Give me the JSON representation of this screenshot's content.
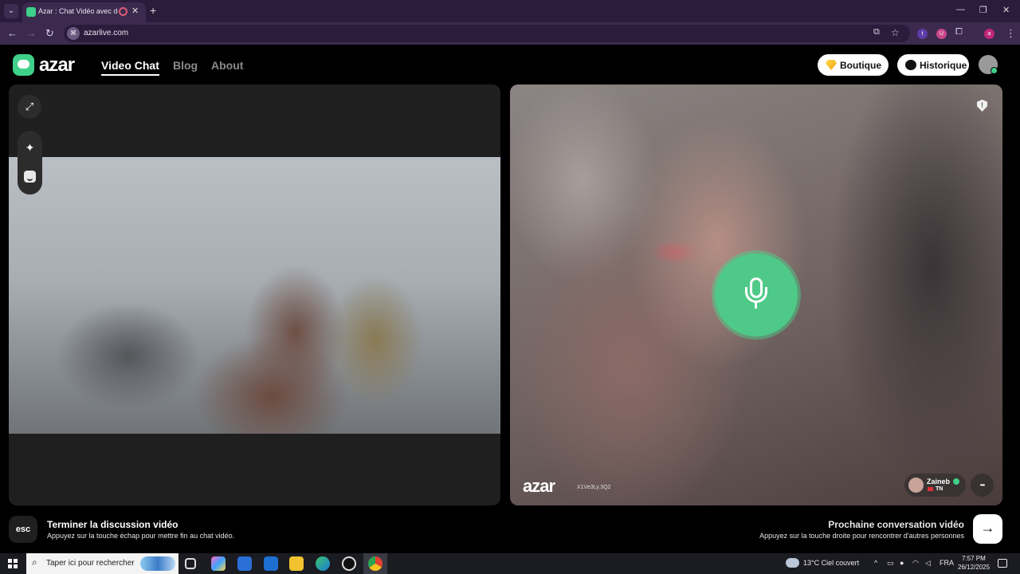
{
  "browser": {
    "tab_title": "Azar : Chat Vidéo avec de n",
    "new_tab_label": "+",
    "address": "azarlive.com",
    "extensions": [
      "t",
      "U",
      "a"
    ]
  },
  "site": {
    "logo_text": "azar",
    "nav": {
      "video_chat": "Video Chat",
      "blog": "Blog",
      "about": "About"
    },
    "boutique_label": "Boutique",
    "historique_label": "Historique"
  },
  "partner": {
    "watermark": "azar",
    "watermark_id": "X1Ve3Ly.3Q2",
    "name": "Zaineb",
    "country": "TN"
  },
  "bottom": {
    "esc_label": "esc",
    "end_title": "Terminer la discussion vidéo",
    "end_desc": "Appuyez sur la touche échap pour mettre fin au chat vidéo.",
    "next_title": "Prochaine conversation vidéo",
    "next_desc": "Appuyez sur la touche droite pour rencontrer d'autres personnes",
    "next_arrow": "→"
  },
  "taskbar": {
    "search_placeholder": "Taper ici pour rechercher",
    "weather": "13°C  Ciel couvert",
    "language": "FRA",
    "time": "7:57 PM",
    "date": "26/12/2025"
  },
  "colors": {
    "brand_green": "#3fd08a",
    "browser_frame": "#2b1c3c"
  }
}
